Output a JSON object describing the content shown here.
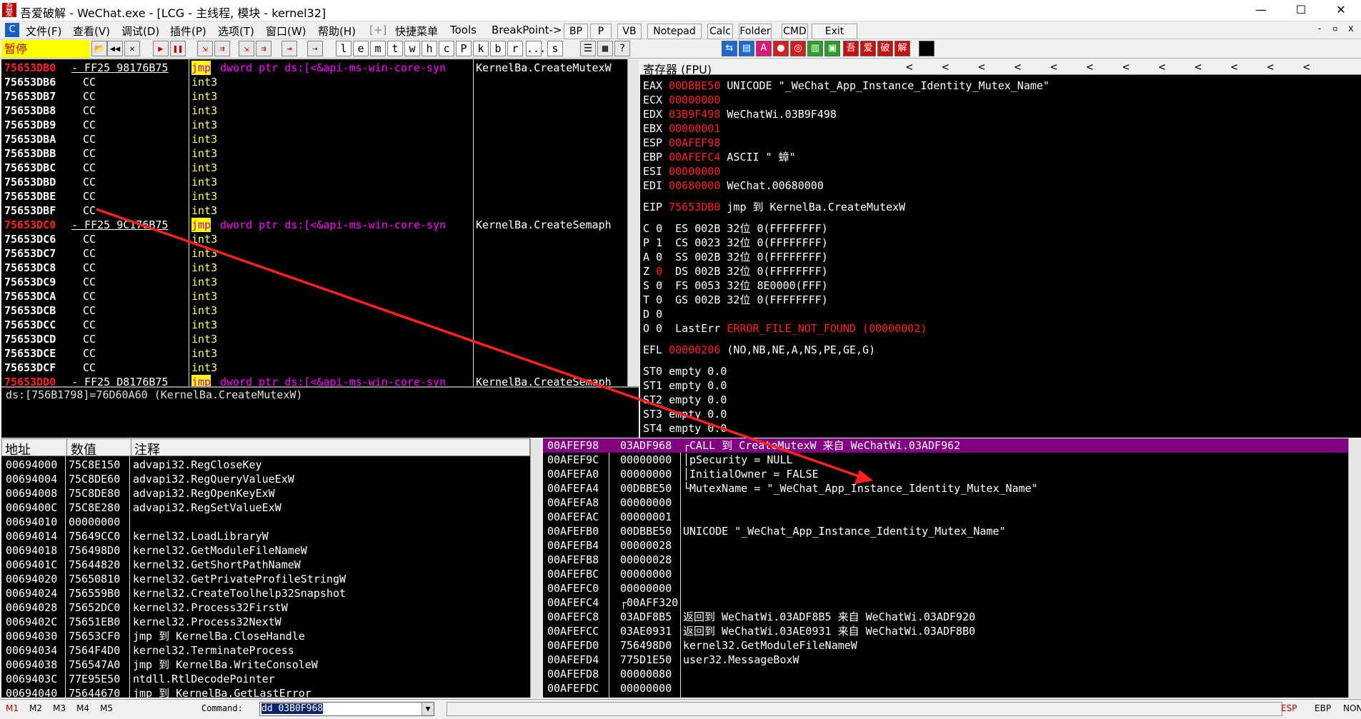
{
  "window": {
    "icon_text": "吾爱",
    "title": "吾爱破解 - WeChat.exe - [LCG - 主线程, 模块 - kernel32]",
    "min": "—",
    "max": "☐",
    "close": "✕"
  },
  "menu": {
    "items": [
      "文件(F)",
      "查看(V)",
      "调试(D)",
      "插件(P)",
      "选项(T)",
      "窗口(W)",
      "帮助(H)",
      "[+]",
      "快捷菜单",
      "Tools",
      "BreakPoint->"
    ],
    "buttons": [
      "BP",
      "P",
      "VB",
      "Notepad",
      "Calc",
      "Folder",
      "CMD",
      "Exit"
    ],
    "mdi_controls": [
      "-",
      "▫",
      "x"
    ]
  },
  "toolbar": {
    "pause_label": "暂停",
    "icons": [
      "open-icon",
      "rewind-icon",
      "close-icon",
      "run-icon",
      "pause-icon",
      "step-into-icon",
      "step-over-icon",
      "trace-into-icon",
      "trace-over-icon",
      "execute-till-return-icon",
      "goto-icon"
    ],
    "letters": [
      "l",
      "e",
      "m",
      "t",
      "w",
      "h",
      "c",
      "P",
      "k",
      "b",
      "r",
      "...",
      "s"
    ],
    "color_buttons": [
      "吾",
      "爱",
      "破",
      "解"
    ]
  },
  "disasm": {
    "rows": [
      {
        "addr": "75653DB0",
        "hex": "- FF25 98176B75",
        "asm": "jmp",
        "op": "dword ptr ds:[<&api-ms-win-core-syn",
        "cmt": "KernelBa.CreateMutexW",
        "hl": true
      },
      {
        "addr": "75653DB6",
        "hex": "CC",
        "asm": "int3"
      },
      {
        "addr": "75653DB7",
        "hex": "CC",
        "asm": "int3"
      },
      {
        "addr": "75653DB8",
        "hex": "CC",
        "asm": "int3"
      },
      {
        "addr": "75653DB9",
        "hex": "CC",
        "asm": "int3"
      },
      {
        "addr": "75653DBA",
        "hex": "CC",
        "asm": "int3"
      },
      {
        "addr": "75653DBB",
        "hex": "CC",
        "asm": "int3"
      },
      {
        "addr": "75653DBC",
        "hex": "CC",
        "asm": "int3"
      },
      {
        "addr": "75653DBD",
        "hex": "CC",
        "asm": "int3"
      },
      {
        "addr": "75653DBE",
        "hex": "CC",
        "asm": "int3"
      },
      {
        "addr": "75653DBF",
        "hex": "CC",
        "asm": "int3"
      },
      {
        "addr": "75653DC0",
        "hex": "- FF25 9C176B75",
        "asm": "jmp",
        "op": "dword ptr ds:[<&api-ms-win-core-syn",
        "cmt": "KernelBa.CreateSemaph",
        "hl": true
      },
      {
        "addr": "75653DC6",
        "hex": "CC",
        "asm": "int3"
      },
      {
        "addr": "75653DC7",
        "hex": "CC",
        "asm": "int3"
      },
      {
        "addr": "75653DC8",
        "hex": "CC",
        "asm": "int3"
      },
      {
        "addr": "75653DC9",
        "hex": "CC",
        "asm": "int3"
      },
      {
        "addr": "75653DCA",
        "hex": "CC",
        "asm": "int3"
      },
      {
        "addr": "75653DCB",
        "hex": "CC",
        "asm": "int3"
      },
      {
        "addr": "75653DCC",
        "hex": "CC",
        "asm": "int3"
      },
      {
        "addr": "75653DCD",
        "hex": "CC",
        "asm": "int3"
      },
      {
        "addr": "75653DCE",
        "hex": "CC",
        "asm": "int3"
      },
      {
        "addr": "75653DCF",
        "hex": "CC",
        "asm": "int3"
      },
      {
        "addr": "75653DD0",
        "hex": "- FF25 D8176B75",
        "asm": "jmp",
        "op": "dword ptr ds:[<&api-ms-win-core-syn",
        "cmt": "KernelBa.CreateSemaph",
        "hl": true
      }
    ],
    "info": "ds:[756B1798]=76D60A60 (KernelBa.CreateMutexW)"
  },
  "registers": {
    "header": "寄存器 (FPU)",
    "arrows": "<   <   <   <   <   <   <   <   <   <   <   <",
    "gp": [
      {
        "name": "EAX",
        "val": "00DBBE50",
        "desc": "UNICODE \"_WeChat_App_Instance_Identity_Mutex_Name\""
      },
      {
        "name": "ECX",
        "val": "00000000",
        "desc": ""
      },
      {
        "name": "EDX",
        "val": "03B9F498",
        "desc": "WeChatWi.03B9F498"
      },
      {
        "name": "EBX",
        "val": "00000001",
        "desc": ""
      },
      {
        "name": "ESP",
        "val": "00AFEF98",
        "desc": ""
      },
      {
        "name": "EBP",
        "val": "00AFEFC4",
        "desc": "ASCII \" 蟑\""
      },
      {
        "name": "ESI",
        "val": "00000000",
        "desc": ""
      },
      {
        "name": "EDI",
        "val": "00680000",
        "desc": "WeChat.00680000"
      }
    ],
    "eip": {
      "name": "EIP",
      "val": "75653DB0",
      "desc": "jmp 到 KernelBa.CreateMutexW"
    },
    "flags": [
      {
        "f": "C",
        "v": "0",
        "seg": "ES",
        "sv": "002B",
        "bits": "32位",
        "rng": "0(FFFFFFFF)"
      },
      {
        "f": "P",
        "v": "1",
        "seg": "CS",
        "sv": "0023",
        "bits": "32位",
        "rng": "0(FFFFFFFF)"
      },
      {
        "f": "A",
        "v": "0",
        "seg": "SS",
        "sv": "002B",
        "bits": "32位",
        "rng": "0(FFFFFFFF)"
      },
      {
        "f": "Z",
        "v": "0",
        "seg": "DS",
        "sv": "002B",
        "bits": "32位",
        "rng": "0(FFFFFFFF)",
        "red": true
      },
      {
        "f": "S",
        "v": "0",
        "seg": "FS",
        "sv": "0053",
        "bits": "32位",
        "rng": "8E0000(FFF)"
      },
      {
        "f": "T",
        "v": "0",
        "seg": "GS",
        "sv": "002B",
        "bits": "32位",
        "rng": "0(FFFFFFFF)"
      },
      {
        "f": "D",
        "v": "0",
        "seg": "",
        "sv": "",
        "bits": "",
        "rng": ""
      }
    ],
    "lasterr": {
      "f": "O",
      "v": "0",
      "label": "LastErr",
      "name": "ERROR_FILE_NOT_FOUND",
      "code": "(00000002)"
    },
    "efl": {
      "name": "EFL",
      "val": "00000206",
      "desc": "(NO,NB,NE,A,NS,PE,GE,G)"
    },
    "fpu": [
      {
        "name": "ST0",
        "desc": "empty 0.0"
      },
      {
        "name": "ST1",
        "desc": "empty 0.0"
      },
      {
        "name": "ST2",
        "desc": "empty 0.0"
      },
      {
        "name": "ST3",
        "desc": "empty 0.0"
      },
      {
        "name": "ST4",
        "desc": "empty 0.0"
      }
    ]
  },
  "dump": {
    "headers": [
      "地址",
      "数值",
      "注释"
    ],
    "rows": [
      {
        "a": "00694000",
        "v": "75C8E150",
        "c": "advapi32.RegCloseKey"
      },
      {
        "a": "00694004",
        "v": "75C8DE60",
        "c": "advapi32.RegQueryValueExW"
      },
      {
        "a": "00694008",
        "v": "75C8DE80",
        "c": "advapi32.RegOpenKeyExW"
      },
      {
        "a": "0069400C",
        "v": "75C8E280",
        "c": "advapi32.RegSetValueExW"
      },
      {
        "a": "00694010",
        "v": "00000000",
        "c": ""
      },
      {
        "a": "00694014",
        "v": "75649CC0",
        "c": "kernel32.LoadLibraryW"
      },
      {
        "a": "00694018",
        "v": "756498D0",
        "c": "kernel32.GetModuleFileNameW"
      },
      {
        "a": "0069401C",
        "v": "75644820",
        "c": "kernel32.GetShortPathNameW"
      },
      {
        "a": "00694020",
        "v": "75650810",
        "c": "kernel32.GetPrivateProfileStringW"
      },
      {
        "a": "00694024",
        "v": "756559B0",
        "c": "kernel32.CreateToolhelp32Snapshot"
      },
      {
        "a": "00694028",
        "v": "75652DC0",
        "c": "kernel32.Process32FirstW"
      },
      {
        "a": "0069402C",
        "v": "75651EB0",
        "c": "kernel32.Process32NextW"
      },
      {
        "a": "00694030",
        "v": "75653CF0",
        "c": "jmp 到 KernelBa.CloseHandle"
      },
      {
        "a": "00694034",
        "v": "7564F4D0",
        "c": "kernel32.TerminateProcess"
      },
      {
        "a": "00694038",
        "v": "756547A0",
        "c": "jmp 到 KernelBa.WriteConsoleW"
      },
      {
        "a": "0069403C",
        "v": "77E95E50",
        "c": "ntdll.RtlDecodePointer"
      },
      {
        "a": "00694040",
        "v": "75644670",
        "c": "jmp 到 KernelBa.GetLastError"
      }
    ]
  },
  "stack": {
    "rows": [
      {
        "a": "00AFEF98",
        "v": "03ADF968",
        "c": "┌CALL 到 CreateMutexW 来自 WeChatWi.03ADF962",
        "hl": true
      },
      {
        "a": "00AFEF9C",
        "v": "00000000",
        "c": "│pSecurity = NULL"
      },
      {
        "a": "00AFEFA0",
        "v": "00000000",
        "c": "│InitialOwner = FALSE"
      },
      {
        "a": "00AFEFA4",
        "v": "00DBBE50",
        "c": "└MutexName = \"_WeChat_App_Instance_Identity_Mutex_Name\""
      },
      {
        "a": "00AFEFA8",
        "v": "00000000",
        "c": ""
      },
      {
        "a": "00AFEFAC",
        "v": "00000001",
        "c": ""
      },
      {
        "a": "00AFEFB0",
        "v": "00DBBE50",
        "c": "UNICODE \"_WeChat_App_Instance_Identity_Mutex_Name\""
      },
      {
        "a": "00AFEFB4",
        "v": "00000028",
        "c": ""
      },
      {
        "a": "00AFEFB8",
        "v": "00000028",
        "c": ""
      },
      {
        "a": "00AFEFBC",
        "v": "00000000",
        "c": ""
      },
      {
        "a": "00AFEFC0",
        "v": "00000000",
        "c": ""
      },
      {
        "a": "00AFEFC4",
        "v": "┌00AFF320",
        "c": ""
      },
      {
        "a": "00AFEFC8",
        "v": "03ADF8B5",
        "c": "返回到 WeChatWi.03ADF8B5 来自 WeChatWi.03ADF920"
      },
      {
        "a": "00AFEFCC",
        "v": "03AE0931",
        "c": "返回到 WeChatWi.03AE0931 来自 WeChatWi.03ADF8B0"
      },
      {
        "a": "00AFEFD0",
        "v": "756498D0",
        "c": "kernel32.GetModuleFileNameW"
      },
      {
        "a": "00AFEFD4",
        "v": "775D1E50",
        "c": "user32.MessageBoxW"
      },
      {
        "a": "00AFEFD8",
        "v": "00000080",
        "c": ""
      },
      {
        "a": "00AFEFDC",
        "v": "00000000",
        "c": ""
      }
    ]
  },
  "status": {
    "m_buttons": [
      "M1",
      "M2",
      "M3",
      "M4",
      "M5"
    ],
    "command_label": "Command:",
    "command_value": "dd 03B0F968",
    "regs": [
      "ESP",
      "EBP",
      "NON"
    ]
  },
  "colors": {
    "highlight_row": "#800080",
    "addr_red": "#ff2020",
    "asm_jmp_bg": "#ffff00",
    "arrow": "#ff2020"
  }
}
